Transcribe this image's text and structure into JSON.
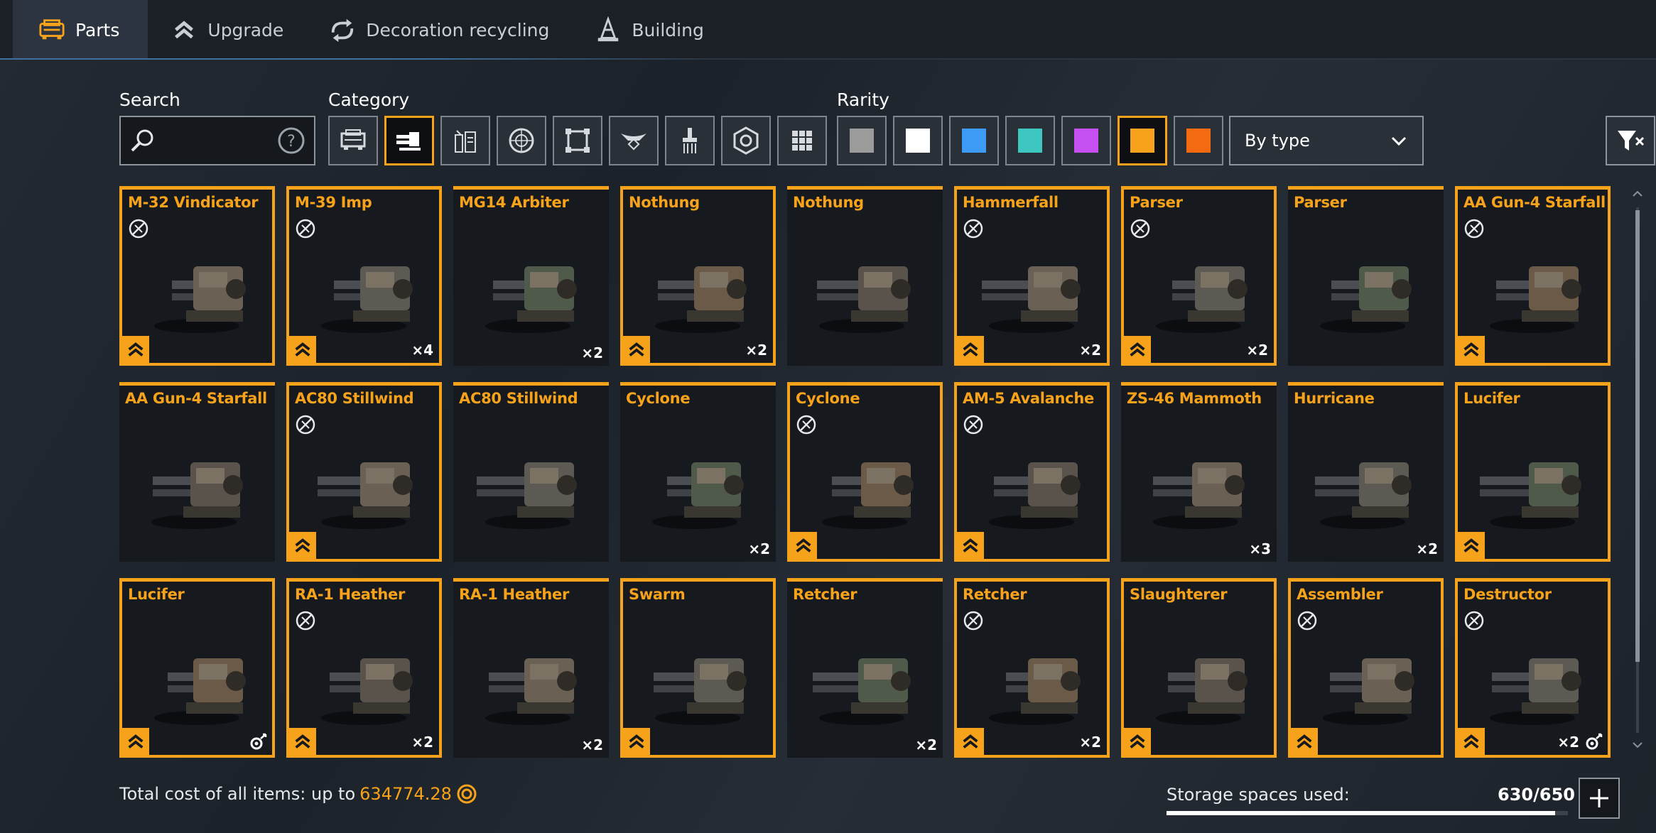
{
  "tabs": [
    {
      "label": "Parts",
      "icon": "car-icon",
      "active": true
    },
    {
      "label": "Upgrade",
      "icon": "upgrade-chevrons-icon"
    },
    {
      "label": "Decoration recycling",
      "icon": "recycle-icon"
    },
    {
      "label": "Building",
      "icon": "cone-icon"
    }
  ],
  "filters": {
    "search_label": "Search",
    "search_value": "",
    "category_label": "Category",
    "rarity_label": "Rarity",
    "sort_value": "By type",
    "categories": [
      "cabin-icon",
      "weapon-icon",
      "module-icon",
      "wheel-icon",
      "frame-icon",
      "decor-icon",
      "paint-icon",
      "sticker-icon",
      "grid-icon"
    ],
    "active_category": 1,
    "rarities": [
      "#9b9b9b",
      "#ffffff",
      "#3d9bf5",
      "#3ec7c0",
      "#c54ff0",
      "#f7a21b",
      "#f36a10"
    ],
    "active_rarity": 5
  },
  "items": [
    {
      "name": "M-32 Vindicator",
      "tag": true,
      "upgrade": true,
      "count": "",
      "framed": true
    },
    {
      "name": "M-39 Imp",
      "tag": true,
      "upgrade": true,
      "count": "×4",
      "framed": true
    },
    {
      "name": "MG14 Arbiter",
      "tag": false,
      "upgrade": false,
      "count": "×2",
      "framed": false
    },
    {
      "name": "Nothung",
      "tag": false,
      "upgrade": true,
      "count": "×2",
      "framed": true
    },
    {
      "name": "Nothung",
      "tag": false,
      "upgrade": false,
      "count": "",
      "framed": false
    },
    {
      "name": "Hammerfall",
      "tag": true,
      "upgrade": true,
      "count": "×2",
      "framed": true
    },
    {
      "name": "Parser",
      "tag": true,
      "upgrade": true,
      "count": "×2",
      "framed": true
    },
    {
      "name": "Parser",
      "tag": false,
      "upgrade": false,
      "count": "",
      "framed": false
    },
    {
      "name": "AA Gun-4 Starfall",
      "tag": true,
      "upgrade": true,
      "count": "",
      "framed": true
    },
    {
      "name": "AA Gun-4 Starfall",
      "tag": false,
      "upgrade": false,
      "count": "",
      "framed": false
    },
    {
      "name": "AC80 Stillwind",
      "tag": true,
      "upgrade": true,
      "count": "",
      "framed": true
    },
    {
      "name": "AC80 Stillwind",
      "tag": false,
      "upgrade": false,
      "count": "",
      "framed": false
    },
    {
      "name": "Cyclone",
      "tag": false,
      "upgrade": false,
      "count": "×2",
      "framed": false
    },
    {
      "name": "Cyclone",
      "tag": true,
      "upgrade": true,
      "count": "",
      "framed": true
    },
    {
      "name": "AM-5 Avalanche",
      "tag": true,
      "upgrade": true,
      "count": "",
      "framed": true
    },
    {
      "name": "ZS-46 Mammoth",
      "tag": false,
      "upgrade": false,
      "count": "×3",
      "framed": false
    },
    {
      "name": "Hurricane",
      "tag": false,
      "upgrade": false,
      "count": "×2",
      "framed": false
    },
    {
      "name": "Lucifer",
      "tag": false,
      "upgrade": true,
      "count": "",
      "framed": true
    },
    {
      "name": "Lucifer",
      "tag": false,
      "upgrade": true,
      "count": "",
      "framed": true,
      "gear": true
    },
    {
      "name": "RA-1 Heather",
      "tag": true,
      "upgrade": true,
      "count": "×2",
      "framed": true
    },
    {
      "name": "RA-1 Heather",
      "tag": false,
      "upgrade": false,
      "count": "×2",
      "framed": false
    },
    {
      "name": "Swarm",
      "tag": false,
      "upgrade": true,
      "count": "",
      "framed": true
    },
    {
      "name": "Retcher",
      "tag": false,
      "upgrade": false,
      "count": "×2",
      "framed": false
    },
    {
      "name": "Retcher",
      "tag": true,
      "upgrade": true,
      "count": "×2",
      "framed": true
    },
    {
      "name": "Slaughterer",
      "tag": false,
      "upgrade": true,
      "count": "",
      "framed": true
    },
    {
      "name": "Assembler",
      "tag": true,
      "upgrade": true,
      "count": "",
      "framed": true
    },
    {
      "name": "Destructor",
      "tag": true,
      "upgrade": true,
      "count": "×2",
      "framed": true,
      "gear": true
    }
  ],
  "footer": {
    "total_cost_label": "Total cost of all items: up to",
    "total_cost_value": "634774.28",
    "storage_label": "Storage spaces used:",
    "storage_value": "630/650",
    "storage_fraction": 0.969
  },
  "colors": {
    "accent": "#f7a21b",
    "panel": "#16191d"
  }
}
